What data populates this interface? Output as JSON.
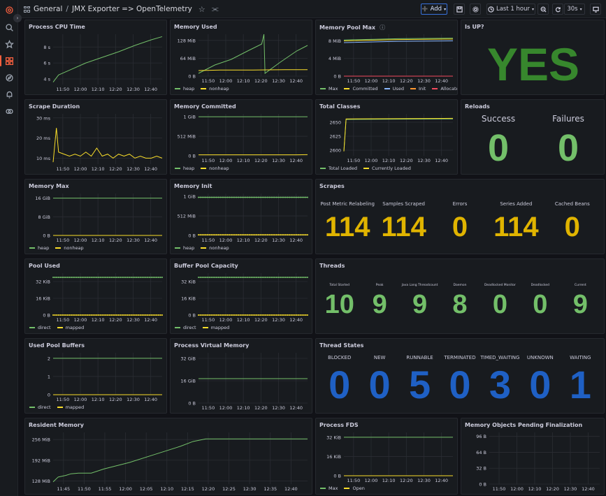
{
  "nav": {
    "icons": [
      "grafana-logo-icon",
      "search-icon",
      "star-icon",
      "dashboards-icon",
      "explore-icon",
      "alerting-icon",
      "connections-icon"
    ]
  },
  "header": {
    "section": "General",
    "separator": "/",
    "title": "JMX Exporter => OpenTelemetry",
    "add_label": "Add",
    "time_range": "Last 1 hour",
    "refresh": "30s"
  },
  "colors": {
    "green": "#73bf69",
    "yellow": "#fade2a",
    "blue": "#8ab8ff",
    "orange": "#ff9830",
    "red": "#f2495c",
    "big_green": "#37872d",
    "stat_blue": "#1f60c4",
    "stat_yellow": "#e0b400"
  },
  "panels": {
    "cpu": {
      "title": "Process CPU Time"
    },
    "mem_used": {
      "title": "Memory Used"
    },
    "pool_max": {
      "title": "Memory Pool Max"
    },
    "isup": {
      "title": "Is UP?",
      "value": "YES"
    },
    "scrape": {
      "title": "Scrape Duration"
    },
    "committed": {
      "title": "Memory Committed"
    },
    "classes": {
      "title": "Total Classes"
    },
    "reloads": {
      "title": "Reloads",
      "success_label": "Success",
      "success_value": "0",
      "failures_label": "Failures",
      "failures_value": "0"
    },
    "mem_max": {
      "title": "Memory Max"
    },
    "mem_init": {
      "title": "Memory Init"
    },
    "scrapes": {
      "title": "Scrapes",
      "stats": [
        {
          "label": "Post Metric Relabeling",
          "value": "114"
        },
        {
          "label": "Samples Scraped",
          "value": "114"
        },
        {
          "label": "Errors",
          "value": "0"
        },
        {
          "label": "Series Added",
          "value": "114"
        },
        {
          "label": "Cached Beans",
          "value": "0"
        }
      ]
    },
    "pool_used": {
      "title": "Pool Used"
    },
    "buffer_cap": {
      "title": "Buffer Pool Capacity"
    },
    "threads": {
      "title": "Threads",
      "stats": [
        {
          "label": "Total Started",
          "value": "10"
        },
        {
          "label": "Peak",
          "value": "9"
        },
        {
          "label": "Java Lang Threadcount",
          "value": "9"
        },
        {
          "label": "Daemon",
          "value": "8"
        },
        {
          "label": "Deadlocked Monitor",
          "value": "0"
        },
        {
          "label": "Deadlocked",
          "value": "0"
        },
        {
          "label": "Current",
          "value": "9"
        }
      ]
    },
    "pool_buffers": {
      "title": "Used Pool Buffers"
    },
    "virt_mem": {
      "title": "Process Virtual Memory"
    },
    "thread_states": {
      "title": "Thread States",
      "stats": [
        {
          "label": "BLOCKED",
          "value": "0"
        },
        {
          "label": "NEW",
          "value": "0"
        },
        {
          "label": "RUNNABLE",
          "value": "5"
        },
        {
          "label": "TERMINATED",
          "value": "0"
        },
        {
          "label": "TIMED_WAITING",
          "value": "3"
        },
        {
          "label": "UNKNOWN",
          "value": "0"
        },
        {
          "label": "WAITING",
          "value": "1"
        }
      ]
    },
    "resident": {
      "title": "Resident Memory"
    },
    "fds": {
      "title": "Process FDS"
    },
    "pending": {
      "title": "Memory Objects Pending Finalization"
    }
  },
  "chart_data": [
    {
      "id": "cpu",
      "type": "line",
      "xticks": [
        "11:50",
        "12:00",
        "12:10",
        "12:20",
        "12:30",
        "12:40"
      ],
      "yticks": [
        "4 s",
        "6 s",
        "8 s"
      ],
      "ylim": [
        3.3,
        9.6
      ],
      "series": [
        {
          "color": "#73bf69",
          "points": [
            [
              0,
              3.6
            ],
            [
              0.05,
              4.5
            ],
            [
              0.15,
              5.1
            ],
            [
              0.3,
              6.0
            ],
            [
              0.45,
              6.7
            ],
            [
              0.6,
              7.4
            ],
            [
              0.75,
              8.2
            ],
            [
              0.9,
              8.9
            ],
            [
              1,
              9.3
            ]
          ]
        }
      ]
    },
    {
      "id": "mem_used",
      "type": "line",
      "xticks": [
        "11:50",
        "12:00",
        "12:10",
        "12:20",
        "12:30",
        "12:40"
      ],
      "yticks": [
        "0 B",
        "64 MiB",
        "128 MiB"
      ],
      "ylim": [
        0,
        150
      ],
      "legend": [
        "heap",
        "nonheap"
      ],
      "series": [
        {
          "name": "heap",
          "color": "#73bf69",
          "points": [
            [
              0,
              10
            ],
            [
              0.15,
              40
            ],
            [
              0.3,
              60
            ],
            [
              0.45,
              90
            ],
            [
              0.58,
              115
            ],
            [
              0.6,
              150
            ],
            [
              0.61,
              10
            ],
            [
              0.75,
              50
            ],
            [
              0.9,
              90
            ],
            [
              1,
              110
            ]
          ]
        },
        {
          "name": "nonheap",
          "color": "#fade2a",
          "points": [
            [
              0,
              20
            ],
            [
              0.2,
              22
            ],
            [
              0.5,
              22
            ],
            [
              0.8,
              23
            ],
            [
              1,
              23
            ]
          ]
        }
      ]
    },
    {
      "id": "pool_max",
      "type": "line",
      "xticks": [
        "11:50",
        "12:00",
        "12:10",
        "12:20",
        "12:30",
        "12:40"
      ],
      "yticks": [
        "0 B",
        "4 MiB",
        "8 MiB"
      ],
      "ylim": [
        0,
        9.5
      ],
      "legend": [
        "Max",
        "Committed",
        "Used",
        "Init",
        "Allocated"
      ],
      "series": [
        {
          "name": "Max",
          "color": "#73bf69",
          "points": [
            [
              0,
              8.2
            ],
            [
              0.5,
              8.5
            ],
            [
              1,
              8.6
            ]
          ]
        },
        {
          "name": "Committed",
          "color": "#fade2a",
          "points": [
            [
              0,
              8.0
            ],
            [
              0.5,
              8.3
            ],
            [
              1,
              8.4
            ]
          ]
        },
        {
          "name": "Used",
          "color": "#8ab8ff",
          "points": [
            [
              0,
              7.6
            ],
            [
              0.5,
              7.9
            ],
            [
              1,
              8.0
            ]
          ]
        },
        {
          "name": "Init",
          "color": "#ff9830",
          "points": [
            [
              0,
              0
            ],
            [
              1,
              0
            ]
          ]
        },
        {
          "name": "Allocated",
          "color": "#f2495c",
          "points": [
            [
              0,
              0
            ],
            [
              1,
              0
            ]
          ]
        }
      ]
    },
    {
      "id": "scrape",
      "type": "line",
      "xticks": [
        "11:50",
        "12:00",
        "12:10",
        "12:20",
        "12:30",
        "12:40"
      ],
      "yticks": [
        "10 ms",
        "20 ms",
        "30 ms"
      ],
      "ylim": [
        7,
        32
      ],
      "series": [
        {
          "color": "#fade2a",
          "points": [
            [
              0,
              8
            ],
            [
              0.03,
              25
            ],
            [
              0.05,
              13
            ],
            [
              0.1,
              12
            ],
            [
              0.15,
              11
            ],
            [
              0.2,
              12
            ],
            [
              0.25,
              11
            ],
            [
              0.3,
              13
            ],
            [
              0.35,
              11
            ],
            [
              0.4,
              15
            ],
            [
              0.45,
              11
            ],
            [
              0.5,
              12
            ],
            [
              0.55,
              10
            ],
            [
              0.6,
              12
            ],
            [
              0.65,
              11
            ],
            [
              0.7,
              12
            ],
            [
              0.75,
              10
            ],
            [
              0.8,
              11
            ],
            [
              0.85,
              10
            ],
            [
              0.9,
              10
            ],
            [
              0.95,
              11
            ],
            [
              1,
              10
            ]
          ]
        }
      ]
    },
    {
      "id": "committed",
      "type": "line",
      "xticks": [
        "11:50",
        "12:00",
        "12:10",
        "12:20",
        "12:30",
        "12:40"
      ],
      "yticks": [
        "0 B",
        "512 MiB",
        "1 GiB"
      ],
      "ylim": [
        0,
        1100
      ],
      "legend": [
        "heap",
        "nonheap"
      ],
      "series": [
        {
          "name": "heap",
          "color": "#73bf69",
          "points": [
            [
              0,
              1024
            ],
            [
              1,
              1024
            ]
          ]
        },
        {
          "name": "nonheap",
          "color": "#fade2a",
          "points": [
            [
              0,
              25
            ],
            [
              0.9,
              25
            ],
            [
              1,
              30
            ]
          ]
        }
      ]
    },
    {
      "id": "classes",
      "type": "line",
      "xticks": [
        "11:50",
        "12:00",
        "12:10",
        "12:20",
        "12:30",
        "12:40"
      ],
      "yticks": [
        "2600",
        "2625",
        "2650"
      ],
      "ylim": [
        2590,
        2665
      ],
      "legend": [
        "Total Loaded",
        "Currently Loaded"
      ],
      "series": [
        {
          "name": "Total Loaded",
          "color": "#73bf69",
          "points": [
            [
              0,
              2598
            ],
            [
              0.02,
              2655
            ],
            [
              1,
              2656
            ]
          ]
        },
        {
          "name": "Currently Loaded",
          "color": "#fade2a",
          "points": [
            [
              0,
              2598
            ],
            [
              0.02,
              2656
            ],
            [
              1,
              2657
            ]
          ]
        }
      ]
    },
    {
      "id": "mem_max",
      "type": "line",
      "xticks": [
        "11:50",
        "12:00",
        "12:10",
        "12:20",
        "12:30",
        "12:40"
      ],
      "yticks": [
        "0 B",
        "8 GiB",
        "16 GiB"
      ],
      "ylim": [
        0,
        18
      ],
      "legend": [
        "heap",
        "nonheap"
      ],
      "series": [
        {
          "name": "heap",
          "color": "#73bf69",
          "points": [
            [
              0,
              16
            ],
            [
              1,
              16
            ]
          ]
        },
        {
          "name": "nonheap",
          "color": "#fade2a",
          "points": [
            [
              0,
              0
            ],
            [
              1,
              0
            ]
          ]
        }
      ]
    },
    {
      "id": "mem_init",
      "type": "line",
      "xticks": [
        "11:50",
        "12:00",
        "12:10",
        "12:20",
        "12:30",
        "12:40"
      ],
      "yticks": [
        "0 B",
        "512 MiB",
        "1 GiB"
      ],
      "ylim": [
        0,
        1100
      ],
      "legend": [
        "heap",
        "nonheap"
      ],
      "dotted": true,
      "series": [
        {
          "name": "heap",
          "color": "#73bf69",
          "points": [
            [
              0,
              1000
            ],
            [
              1,
              1000
            ]
          ]
        },
        {
          "name": "nonheap",
          "color": "#fade2a",
          "points": [
            [
              0,
              15
            ],
            [
              1,
              15
            ]
          ]
        }
      ]
    },
    {
      "id": "pool_used",
      "type": "line",
      "xticks": [
        "11:50",
        "12:00",
        "12:10",
        "12:20",
        "12:30",
        "12:40"
      ],
      "yticks": [
        "0 B",
        "16 KiB",
        "32 KiB"
      ],
      "ylim": [
        0,
        40
      ],
      "legend": [
        "direct",
        "mapped"
      ],
      "dotted": true,
      "series": [
        {
          "name": "direct",
          "color": "#73bf69",
          "points": [
            [
              0,
              36
            ],
            [
              1,
              36
            ]
          ]
        },
        {
          "name": "mapped",
          "color": "#fade2a",
          "points": [
            [
              0,
              0
            ],
            [
              1,
              0
            ]
          ]
        }
      ]
    },
    {
      "id": "buffer_cap",
      "type": "line",
      "xticks": [
        "11:50",
        "12:00",
        "12:10",
        "12:20",
        "12:30",
        "12:40"
      ],
      "yticks": [
        "0 B",
        "16 KiB",
        "32 KiB"
      ],
      "ylim": [
        0,
        40
      ],
      "legend": [
        "direct",
        "mapped"
      ],
      "dotted": true,
      "series": [
        {
          "name": "direct",
          "color": "#73bf69",
          "points": [
            [
              0,
              36
            ],
            [
              1,
              36
            ]
          ]
        },
        {
          "name": "mapped",
          "color": "#fade2a",
          "points": [
            [
              0,
              0
            ],
            [
              1,
              0
            ]
          ]
        }
      ]
    },
    {
      "id": "pool_buffers",
      "type": "line",
      "xticks": [
        "11:50",
        "12:00",
        "12:10",
        "12:20",
        "12:30",
        "12:40"
      ],
      "yticks": [
        "0",
        "1",
        "2"
      ],
      "ylim": [
        0,
        2.3
      ],
      "legend": [
        "direct",
        "mapped"
      ],
      "series": [
        {
          "name": "direct",
          "color": "#73bf69",
          "points": [
            [
              0,
              2
            ],
            [
              1,
              2
            ]
          ]
        },
        {
          "name": "mapped",
          "color": "#fade2a",
          "points": [
            [
              0,
              0
            ],
            [
              1,
              0
            ]
          ]
        }
      ]
    },
    {
      "id": "virt_mem",
      "type": "line",
      "xticks": [
        "11:50",
        "12:00",
        "12:10",
        "12:20",
        "12:30",
        "12:40"
      ],
      "yticks": [
        "0 B",
        "16 GiB",
        "32 GiB"
      ],
      "ylim": [
        0,
        36
      ],
      "series": [
        {
          "color": "#73bf69",
          "points": [
            [
              0,
              17.5
            ],
            [
              1,
              17.5
            ]
          ]
        }
      ]
    },
    {
      "id": "resident",
      "type": "line",
      "xticks": [
        "11:45",
        "11:50",
        "11:55",
        "12:00",
        "12:05",
        "12:10",
        "12:15",
        "12:20",
        "12:25",
        "12:30",
        "12:35",
        "12:40"
      ],
      "yticks": [
        "128 MiB",
        "192 MiB",
        "256 MiB"
      ],
      "ylim": [
        118,
        278
      ],
      "series": [
        {
          "color": "#73bf69",
          "points": [
            [
              0,
              125
            ],
            [
              0.02,
              140
            ],
            [
              0.05,
              145
            ],
            [
              0.07,
              150
            ],
            [
              0.1,
              152
            ],
            [
              0.15,
              152
            ],
            [
              0.2,
              165
            ],
            [
              0.3,
              185
            ],
            [
              0.4,
              210
            ],
            [
              0.5,
              235
            ],
            [
              0.55,
              250
            ],
            [
              0.6,
              258
            ],
            [
              0.65,
              258
            ],
            [
              0.75,
              258
            ],
            [
              0.85,
              258
            ],
            [
              0.95,
              258
            ],
            [
              1,
              258
            ]
          ]
        }
      ]
    },
    {
      "id": "fds",
      "type": "line",
      "xticks": [
        "11:50",
        "12:00",
        "12:10",
        "12:20",
        "12:30",
        "12:40"
      ],
      "yticks": [
        "0 B",
        "16 KiB",
        "32 KiB"
      ],
      "ylim": [
        0,
        36
      ],
      "legend": [
        "Max",
        "Open"
      ],
      "series": [
        {
          "name": "Max",
          "color": "#73bf69",
          "points": [
            [
              0,
              32
            ],
            [
              1,
              32
            ]
          ]
        },
        {
          "name": "Open",
          "color": "#fade2a",
          "points": [
            [
              0,
              0
            ],
            [
              1,
              0
            ]
          ]
        }
      ]
    },
    {
      "id": "pending",
      "type": "line",
      "xticks": [
        "11:50",
        "12:00",
        "12:10",
        "12:20",
        "12:30",
        "12:40"
      ],
      "yticks": [
        "0 B",
        "32 B",
        "64 B",
        "96 B"
      ],
      "ylim": [
        0,
        104
      ],
      "series": []
    }
  ]
}
